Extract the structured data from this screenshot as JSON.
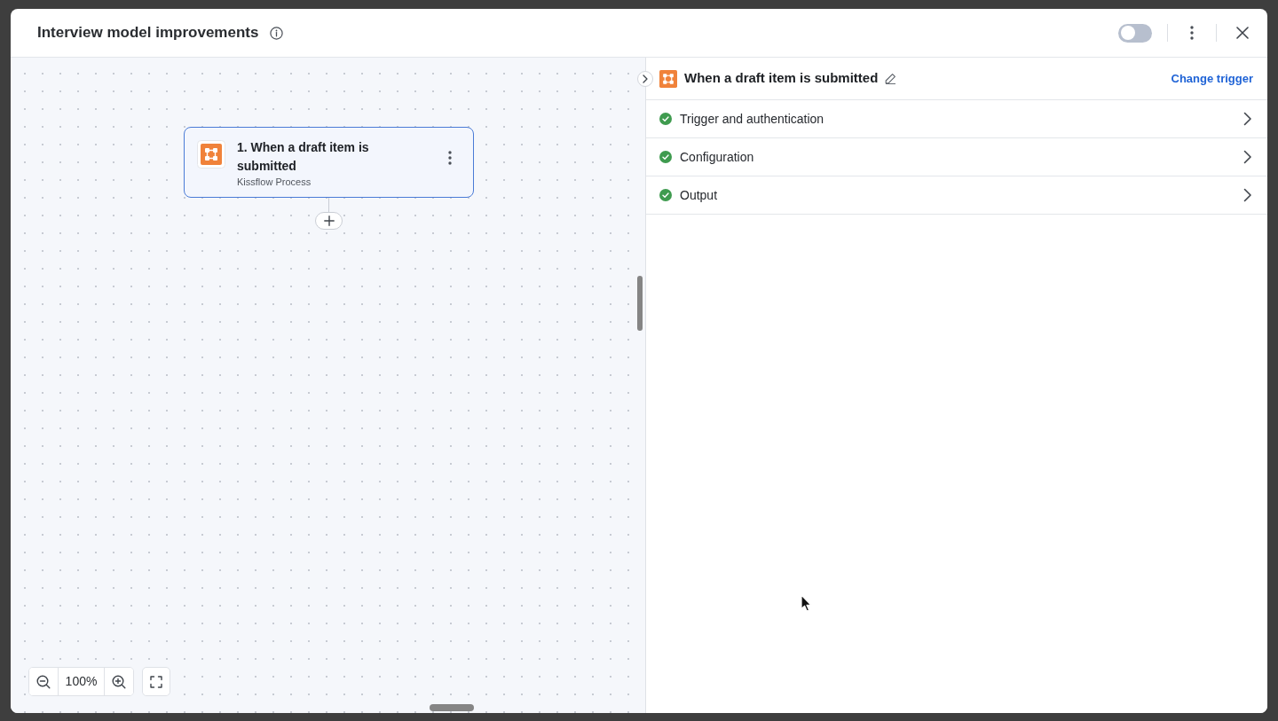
{
  "window": {
    "title": "Interview model improvements",
    "toggle": {
      "on": false
    }
  },
  "canvas": {
    "nodes": [
      {
        "title": "1. When a draft item is submitted",
        "subtitle": "Kissflow Process",
        "selected": true
      }
    ],
    "zoom": "100%"
  },
  "panel": {
    "title": "When a draft item is submitted",
    "action": "Change trigger",
    "sections": [
      {
        "label": "Trigger and authentication",
        "complete": true
      },
      {
        "label": "Configuration",
        "complete": true
      },
      {
        "label": "Output",
        "complete": true
      }
    ]
  }
}
